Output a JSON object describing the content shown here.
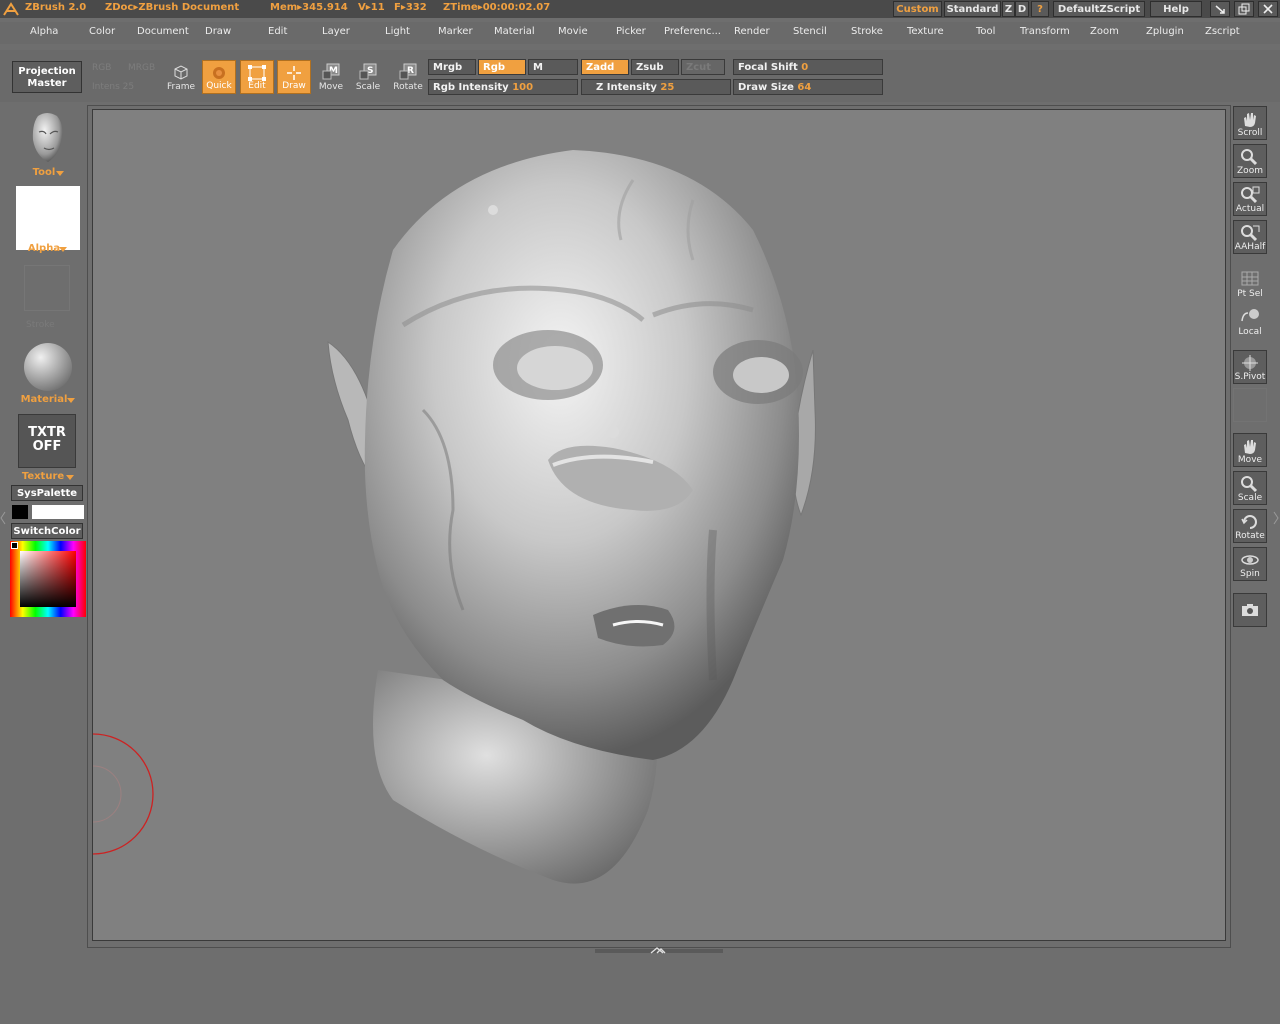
{
  "titlebar": {
    "app": "ZBrush 2.0",
    "doc": "ZDoc▸ZBrush Document",
    "mem": "Mem▸345.914",
    "verts": "V▸11",
    "faces": "F▸332",
    "ztime": "ZTime▸00:00:02.07",
    "buttons": {
      "custom": "Custom",
      "standard": "Standard",
      "z": "Z",
      "d": "D",
      "q": "?",
      "script": "DefaultZScript",
      "help": "Help"
    }
  },
  "menu": [
    "Alpha",
    "Color",
    "Document",
    "Draw",
    "Edit",
    "Layer",
    "Light",
    "Marker",
    "Material",
    "Movie",
    "Picker",
    "Preferenc...",
    "Render",
    "Stencil",
    "Stroke",
    "Texture",
    "Tool",
    "Transform",
    "Zoom",
    "Zplugin",
    "Zscript"
  ],
  "shelf": {
    "projection_master": [
      "Projection",
      "Master"
    ],
    "ghost": {
      "rgb": "RGB",
      "mrgb": "MRGB",
      "intensity": "Intens 25"
    },
    "tools": {
      "frame": "Frame",
      "quick": "Quick",
      "edit": "Edit",
      "draw": "Draw",
      "move": "Move",
      "scale": "Scale",
      "rotate": "Rotate"
    },
    "mrgb": "Mrgb",
    "rgb": "Rgb",
    "m": "M",
    "zadd": "Zadd",
    "zsub": "Zsub",
    "zcut": "Zcut",
    "rgb_intensity": {
      "label": "Rgb Intensity",
      "value": "100"
    },
    "z_intensity": {
      "label": "Z Intensity",
      "value": "25"
    },
    "focal_shift": {
      "label": "Focal Shift",
      "value": "0"
    },
    "draw_size": {
      "label": "Draw Size",
      "value": "64"
    }
  },
  "left": {
    "tool": "Tool",
    "alpha": "Alpha",
    "stroke": "Stroke",
    "material": "Material",
    "texture_badge": [
      "TXTR",
      "OFF"
    ],
    "texture": "Texture",
    "syspalette": "SysPalette",
    "switchcolor": "SwitchColor"
  },
  "right": {
    "scroll": "Scroll",
    "zoom": "Zoom",
    "actual": "Actual",
    "aahalf": "AAHalf",
    "ptsel": "Pt Sel",
    "local": "Local",
    "spivot": "S.Pivot",
    "move": "Move",
    "scale": "Scale",
    "rotate": "Rotate",
    "spin": "Spin"
  },
  "colors": {
    "accent": "#f0a040",
    "panel": "#6a6a6a",
    "canvas": "#808080",
    "brush_cursor": "#cc2222"
  }
}
